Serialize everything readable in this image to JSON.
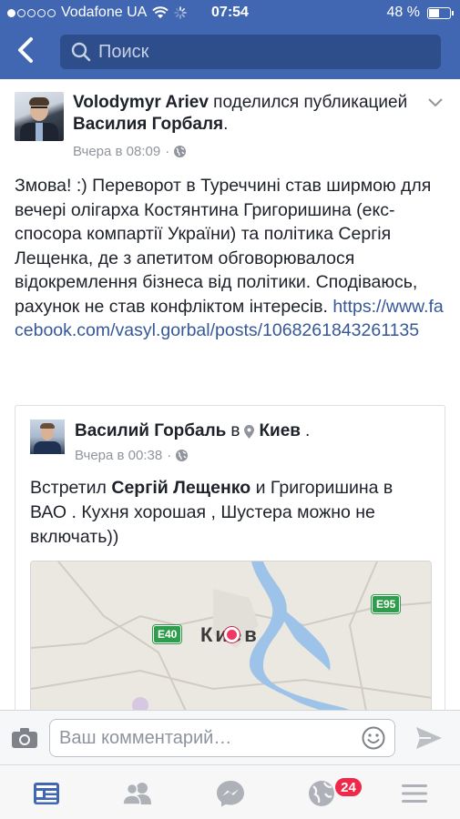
{
  "status_bar": {
    "carrier": "Vodafone UA",
    "time": "07:54",
    "battery": "48 %"
  },
  "search": {
    "placeholder": "Поиск"
  },
  "post": {
    "author": "Volodymyr Ariev",
    "action": "поделился публикацией",
    "shared_from": "Василия Горбаля",
    "time": "Вчера в 08:09",
    "text": "Змова! :) Переворот в Туреччині став ширмою для вечері олігарха Костянтина Григоришина (екс-спосора компартії України) та політика Сергія Лещенка, де з апетитом обговорювалося відокремлення бізнеса від політики. Сподіваюсь, рахунок не став конфліктом інтересів.",
    "link": "https://www.facebook.com/vasyl.gorbal/posts/1068261843261135"
  },
  "shared_post": {
    "author": "Василий Горбаль",
    "in_word": "в",
    "location": "Киев",
    "time": "Вчера в 00:38",
    "text_before": "Встретил ",
    "text_tag": "Сергій Лещенко",
    "text_after": " и Григоришина в ВАО . Кухня хорошая , Шустера можно не включать))",
    "map": {
      "city": "Киев",
      "road_left": "E40",
      "road_right": "E95"
    }
  },
  "comment": {
    "placeholder": "Ваш комментарий…"
  },
  "tabbar": {
    "notifications_count": "24"
  },
  "colors": {
    "brand": "#4267b2",
    "link": "#365899",
    "badge": "#f02849"
  }
}
